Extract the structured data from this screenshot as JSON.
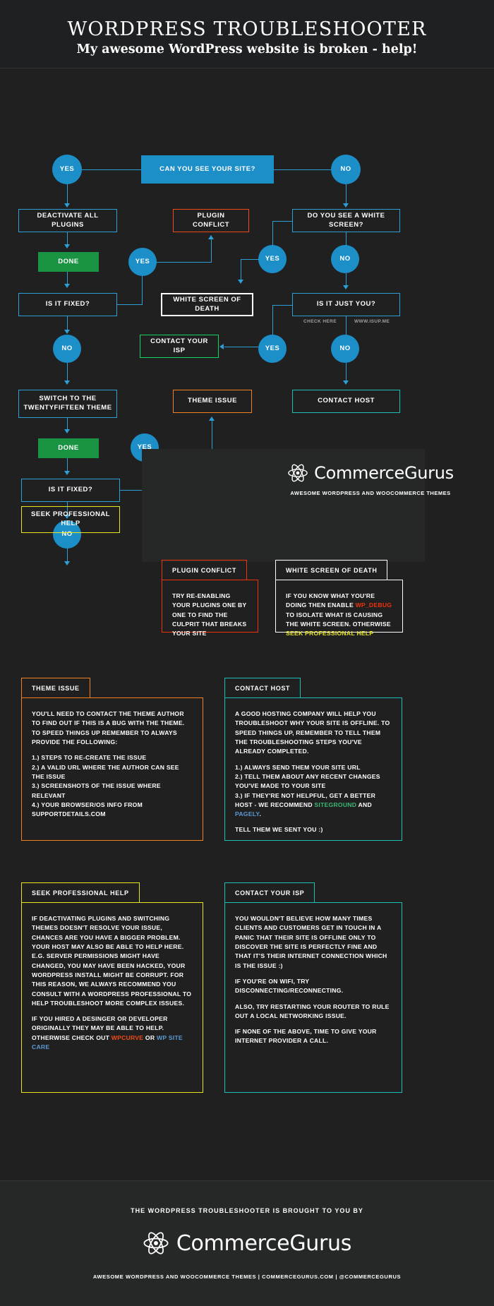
{
  "header": {
    "title": "WORDPRESS TROUBLESHOOTER",
    "subtitle": "My awesome WordPress website is broken - help!"
  },
  "flow": {
    "nodes": [
      {
        "id": "yes1",
        "label": "YES"
      },
      {
        "id": "q1",
        "label": "CAN YOU SEE YOUR SITE?"
      },
      {
        "id": "no1",
        "label": "NO"
      },
      {
        "id": "deact",
        "label": "DEACTIVATE ALL PLUGINS"
      },
      {
        "id": "pconf",
        "label": "PLUGIN CONFLICT"
      },
      {
        "id": "white",
        "label": "DO YOU SEE A WHITE SCREEN?"
      },
      {
        "id": "done1",
        "label": "DONE"
      },
      {
        "id": "yes2",
        "label": "YES"
      },
      {
        "id": "yes3",
        "label": "YES"
      },
      {
        "id": "no2",
        "label": "NO"
      },
      {
        "id": "fixed1",
        "label": "IS IT FIXED?"
      },
      {
        "id": "wsod",
        "label": "WHITE SCREEN OF DEATH"
      },
      {
        "id": "justyou",
        "label": "IS IT JUST YOU?"
      },
      {
        "id": "no3",
        "label": "NO"
      },
      {
        "id": "isp",
        "label": "CONTACT YOUR ISP"
      },
      {
        "id": "yes4",
        "label": "YES"
      },
      {
        "id": "no4",
        "label": "NO"
      },
      {
        "id": "switch",
        "label": "SWITCH TO THE\nTWENTYFIFTEEN THEME"
      },
      {
        "id": "theme",
        "label": "THEME ISSUE"
      },
      {
        "id": "host",
        "label": "CONTACT HOST"
      },
      {
        "id": "done2",
        "label": "DONE"
      },
      {
        "id": "yes5",
        "label": "YES"
      },
      {
        "id": "fixed2",
        "label": "IS IT FIXED?"
      },
      {
        "id": "no5",
        "label": "NO"
      },
      {
        "id": "seek",
        "label": "SEEK PROFESSIONAL HELP"
      }
    ],
    "captions": {
      "check_here": "CHECK HERE",
      "isup": "WWW.ISUP.ME"
    }
  },
  "brand": {
    "name": "CommerceGurus",
    "icon": "atom-icon",
    "tagline": "AWESOME WORDPRESS AND WOOCOMMERCE THEMES"
  },
  "cards": {
    "plugin_conflict": {
      "title": "PLUGIN CONFLICT",
      "body": "TRY RE-ENABLING YOUR PLUGINS ONE BY ONE TO FIND THE CULPRIT THAT BREAKS YOUR SITE"
    },
    "white_screen": {
      "title": "WHITE SCREEN OF DEATH",
      "p1a": "IF YOU KNOW WHAT YOU'RE DOING THEN ENABLE ",
      "p1b": "WP_DEBUG",
      "p1c": " TO ISOLATE WHAT IS CAUSING THE WHITE SCREEN. OTHERWISE ",
      "p1d": "SEEK PROFESSIONAL HELP"
    },
    "theme_issue": {
      "title": "THEME ISSUE",
      "p1": "YOU'LL NEED TO CONTACT THE THEME AUTHOR TO FIND OUT IF THIS IS A BUG WITH THE THEME. TO SPEED THINGS UP REMEMBER TO ALWAYS PROVIDE THE FOLLOWING:",
      "p2": "1.) STEPS TO RE-CREATE THE ISSUE\n2.) A VALID URL WHERE THE AUTHOR CAN SEE THE ISSUE\n3.) SCREENSHOTS OF THE ISSUE WHERE RELEVANT\n4.) YOUR BROWSER/OS INFO FROM SUPPORTDETAILS.COM"
    },
    "contact_host": {
      "title": "CONTACT HOST",
      "p1": "A GOOD HOSTING COMPANY WILL HELP YOU TROUBLESHOOT WHY YOUR SITE IS OFFLINE. TO SPEED THINGS UP, REMEMBER TO TELL THEM THE TROUBLESHOOTING STEPS YOU'VE ALREADY COMPLETED.",
      "p2a": "1.) ALWAYS SEND THEM YOUR SITE URL\n2.) TELL THEM ABOUT ANY RECENT CHANGES YOU'VE MADE TO YOUR SITE\n3.) IF THEY'RE NOT HELPFUL, GET A BETTER HOST - WE RECOMMEND ",
      "p2b": "SITEGROUND",
      "p2c": " AND ",
      "p2d": "PAGELY",
      "p2e": ".",
      "p3": "TELL THEM WE SENT YOU :)"
    },
    "seek_help": {
      "title": "SEEK PROFESSIONAL HELP",
      "p1": "IF DEACTIVATING PLUGINS AND SWITCHING THEMES DOESN'T RESOLVE YOUR ISSUE, CHANCES ARE YOU HAVE A BIGGER PROBLEM. YOUR HOST MAY ALSO BE ABLE TO HELP HERE. E.G. SERVER PERMISSIONS MIGHT HAVE CHANGED, YOU MAY HAVE BEEN HACKED, YOUR WORDPRESS INSTALL MIGHT BE CORRUPT. FOR THIS REASON, WE ALWAYS RECOMMEND YOU CONSULT WITH A WORDPRESS PROFESSIONAL TO HELP TROUBLESHOOT MORE COMPLEX ISSUES.",
      "p2a": "IF YOU HIRED A DESINGER OR DEVELOPER ORIGINALLY THEY MAY BE ABLE TO HELP. OTHERWISE CHECK OUT ",
      "p2b": "WPCURVE",
      "p2c": " OR ",
      "p2d": "WP SITE CARE"
    },
    "contact_isp": {
      "title": "CONTACT YOUR ISP",
      "p1": "YOU WOULDN'T BELIEVE HOW MANY TIMES CLIENTS AND CUSTOMERS GET IN TOUCH IN A PANIC THAT THEIR SITE IS OFFLINE ONLY TO DISCOVER THE SITE IS PERFECTLY FINE AND THAT IT'S THEIR INTERNET CONNECTION WHICH IS THE ISSUE :)",
      "p2": "IF YOU'RE ON WIFI, TRY DISCONNECTING/RECONNECTING.",
      "p3": "ALSO, TRY RESTARTING YOUR ROUTER TO RULE OUT A LOCAL NETWORKING ISSUE.",
      "p4": "IF NONE OF THE ABOVE, TIME TO GIVE YOUR INTERNET PROVIDER A CALL."
    }
  },
  "footer": {
    "lead": "THE WORDPRESS TROUBLESHOOTER IS BROUGHT TO YOU BY",
    "brand": "CommerceGurus",
    "fine": "AWESOME WORDPRESS AND WOOCOMMERCE THEMES | COMMERCEGURUS.COM | @COMMERCEGURUS"
  },
  "colors": {
    "background": "#202020",
    "blue": "#2c9fd6",
    "blue_fill": "#1c8fc9",
    "green_fill": "#1a9342",
    "red": "#f0330a",
    "orange": "#f08020",
    "teal": "#19bfb5",
    "yellow": "#e8e420",
    "bright_green": "#12d45e"
  }
}
